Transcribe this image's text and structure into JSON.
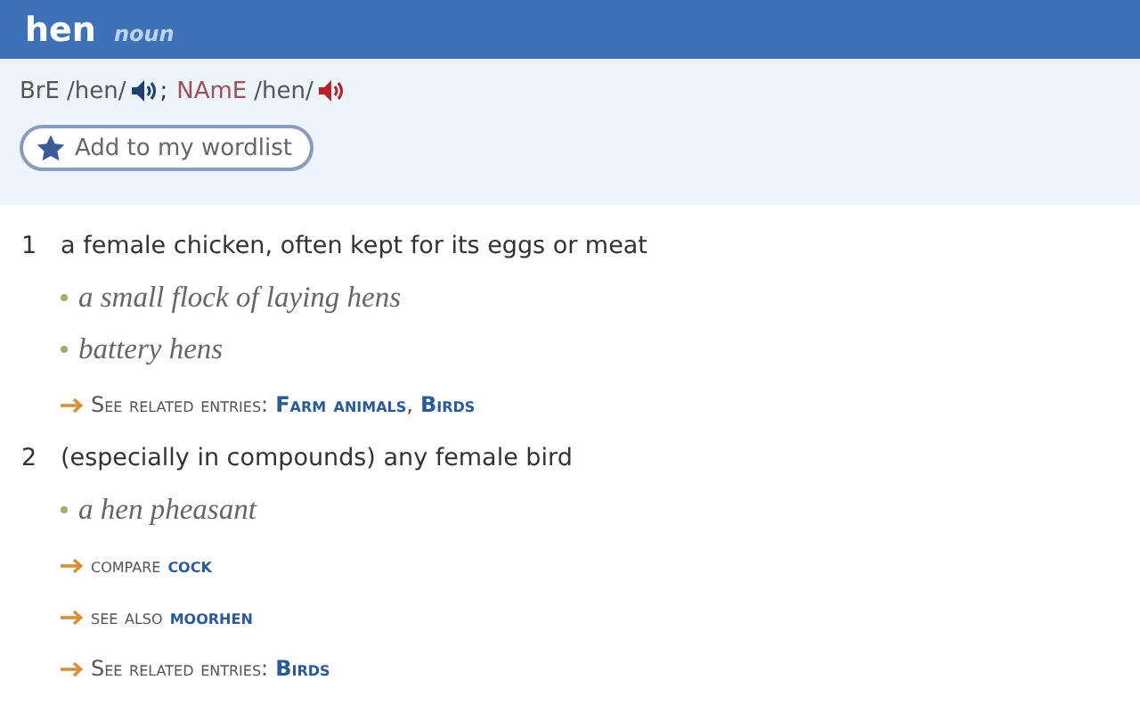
{
  "headword": "hen",
  "pos": "noun",
  "pronunciations": [
    {
      "kind": "bre",
      "label": "BrE",
      "ipa": "/hen/",
      "separator": ";"
    },
    {
      "kind": "name",
      "label": "NAmE",
      "ipa": "/hen/"
    }
  ],
  "wordlist_button": "Add to my wordlist",
  "senses": [
    {
      "number": "1",
      "definition": "a female chicken, often kept for its eggs or meat",
      "examples": [
        "a small flock of laying hens",
        "battery hens"
      ],
      "xrefs": [
        {
          "label": "See related entries:",
          "links": [
            "Farm animals",
            "Birds"
          ],
          "separator": ","
        }
      ]
    },
    {
      "number": "2",
      "definition": "(especially in compounds) any female bird",
      "examples": [
        "a hen pheasant"
      ],
      "xrefs": [
        {
          "label": "compare",
          "links": [
            "cock"
          ]
        },
        {
          "label": "see also",
          "links": [
            "moorhen"
          ]
        },
        {
          "label": "See related entries:",
          "links": [
            "Birds"
          ]
        }
      ]
    }
  ]
}
